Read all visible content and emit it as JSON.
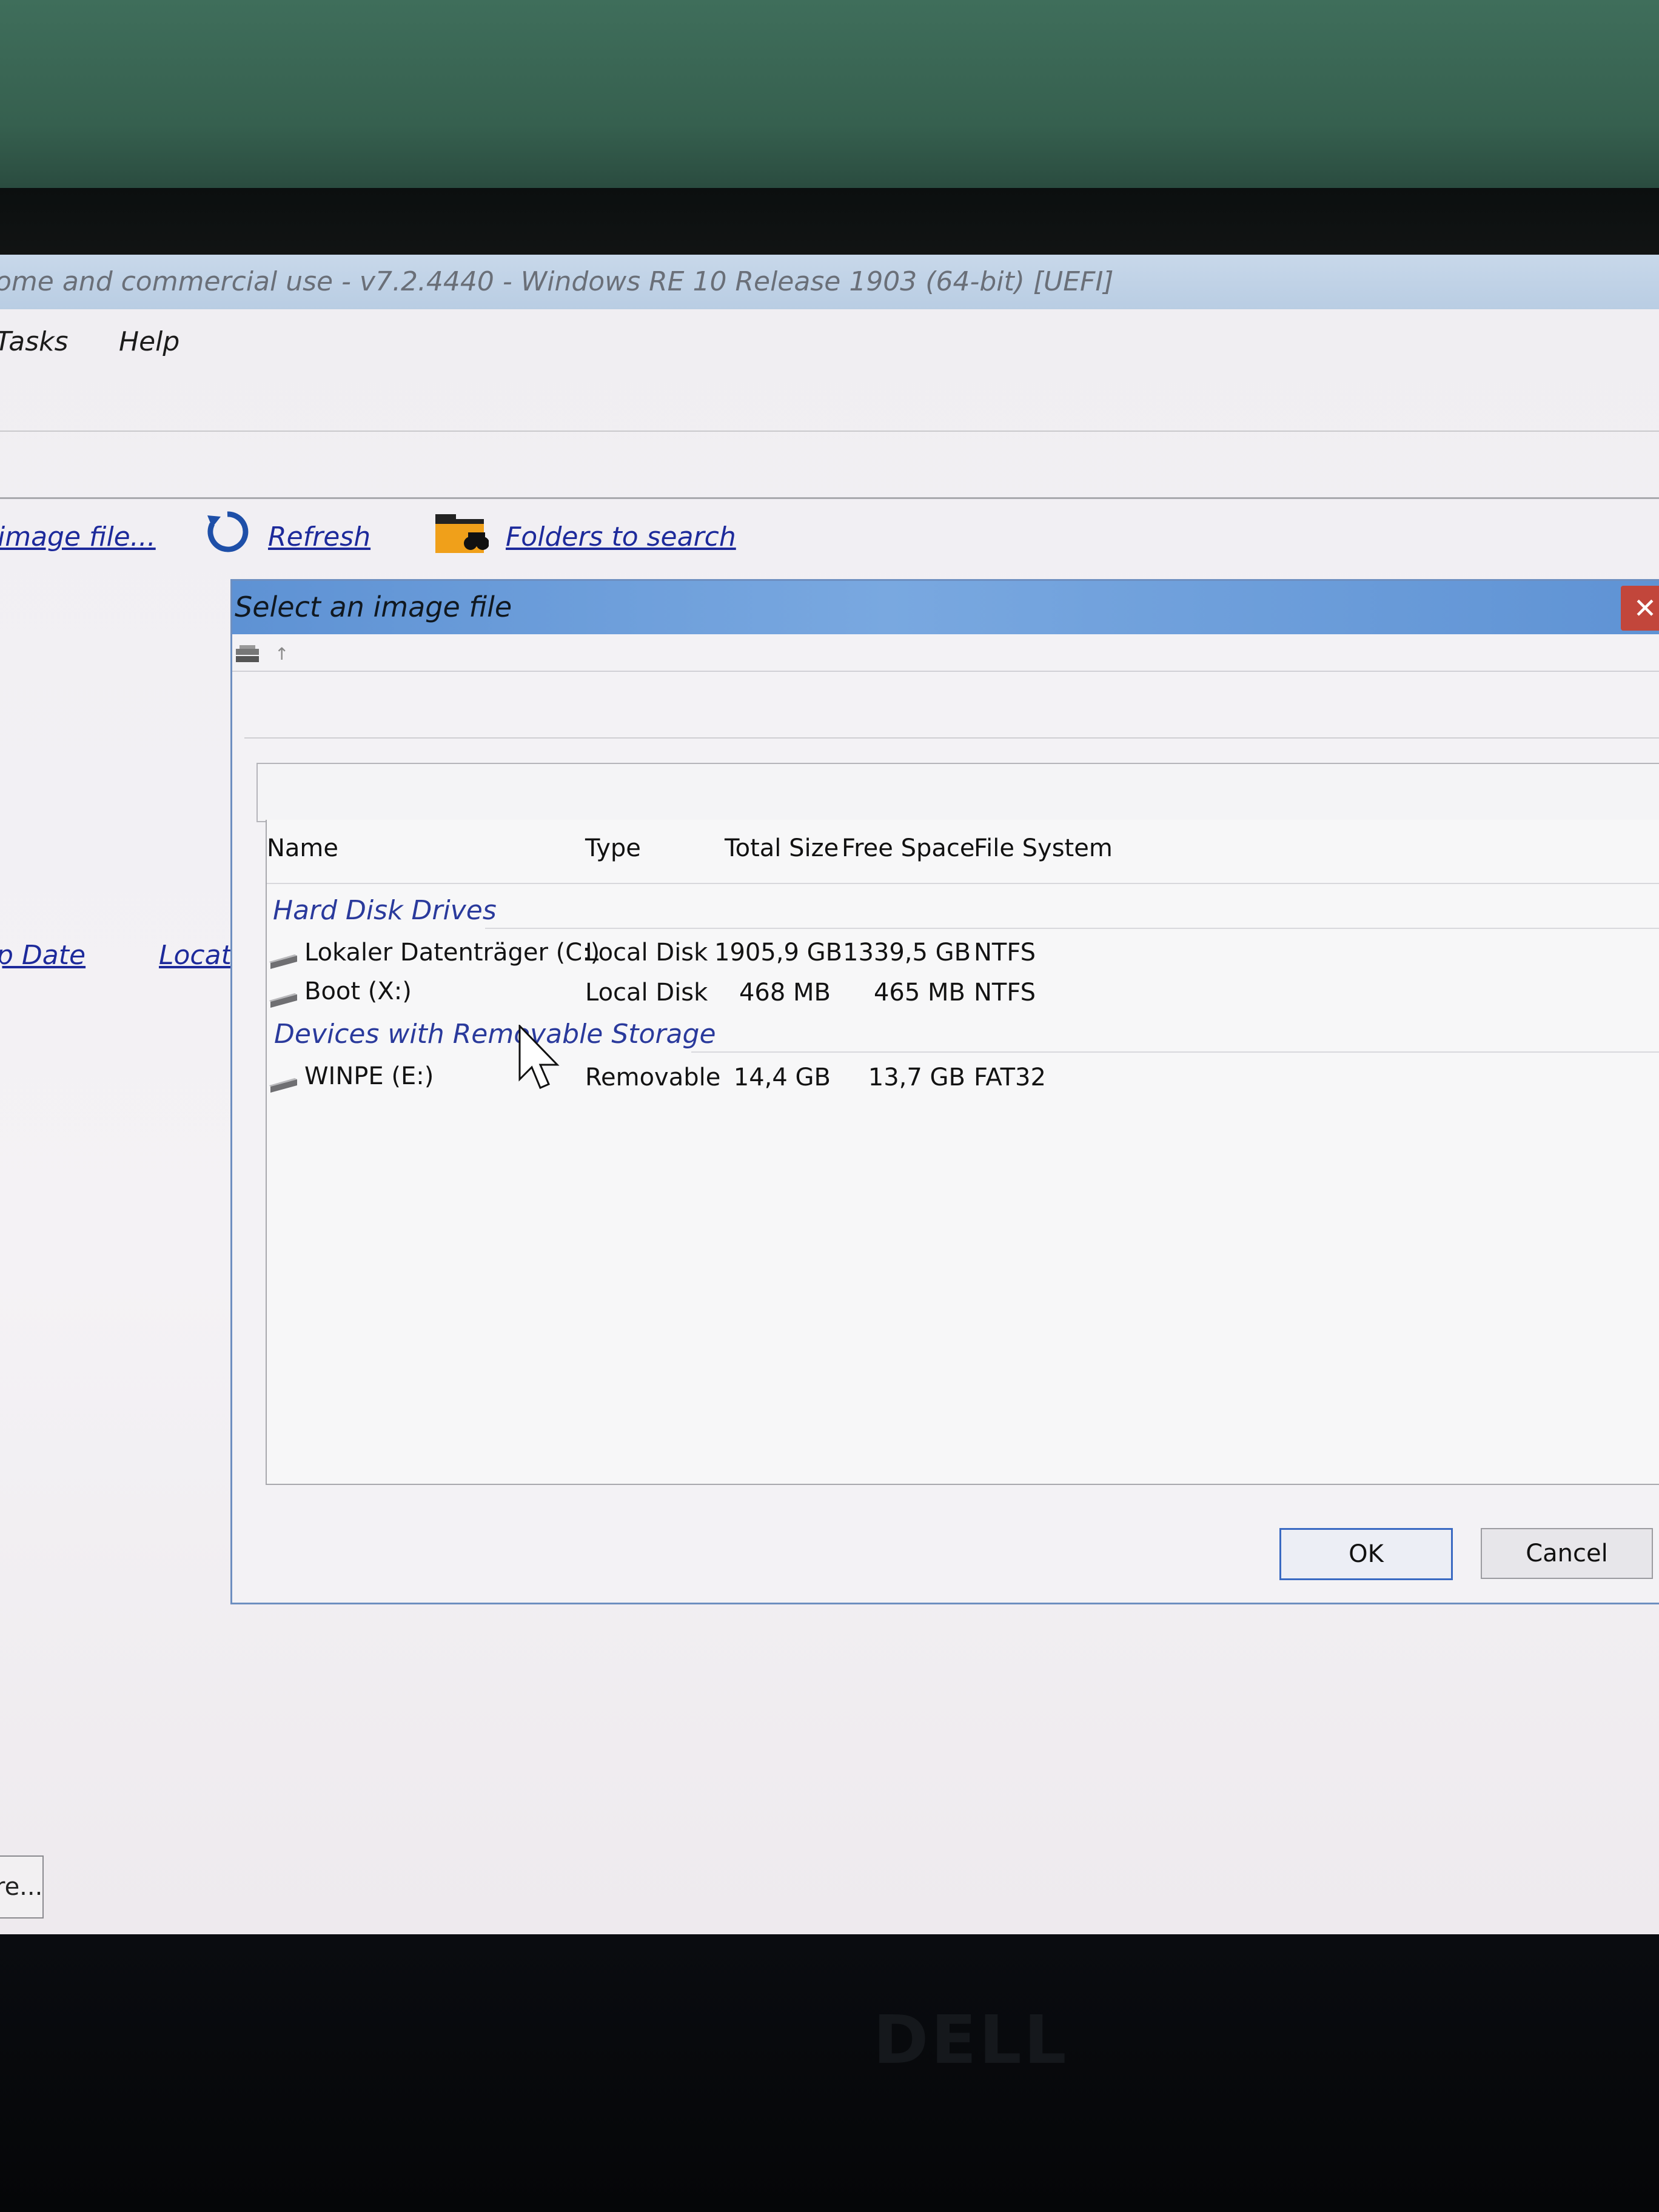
{
  "window": {
    "title": "ome and commercial use - v7.2.4440 - Windows RE 10 Release 1903 (64-bit)  [UEFI]"
  },
  "menu": {
    "items": [
      "Tasks",
      "Help"
    ]
  },
  "toolbar": {
    "image_file_label": "image file...",
    "refresh_label": "Refresh",
    "folders_label": "Folders to search"
  },
  "left_columns": {
    "date_label": "p Date",
    "location_label": "Locati"
  },
  "bottom_button": {
    "label": "re..."
  },
  "dialog": {
    "title": "Select an image file",
    "close_glyph": "✕",
    "columns": {
      "name": "Name",
      "type": "Type",
      "total": "Total Size",
      "free": "Free Space",
      "fs": "File System"
    },
    "groups": [
      {
        "label": "Hard Disk Drives",
        "rows": [
          {
            "name": "Lokaler Datenträger (C:)",
            "type": "Local Disk",
            "total": "1905,9 GB",
            "free": "1339,5 GB",
            "fs": "NTFS"
          },
          {
            "name": "Boot (X:)",
            "type": "Local Disk",
            "total": "468 MB",
            "free": "465 MB",
            "fs": "NTFS"
          }
        ]
      },
      {
        "label": "Devices with Removable Storage",
        "rows": [
          {
            "name": "WINPE (E:)",
            "type": "Removable",
            "total": "14,4 GB",
            "free": "13,7 GB",
            "fs": "FAT32"
          }
        ]
      }
    ],
    "ok_label": "OK",
    "cancel_label": "Cancel"
  },
  "brand": "DELL",
  "icons": {
    "refresh": "refresh-icon",
    "folder_search": "folder-search-icon",
    "drive": "drive-icon",
    "close": "close-icon",
    "cursor": "mouse-cursor-icon"
  },
  "colors": {
    "link": "#1d2a9b",
    "dialog_title": "#5e92d4",
    "group_text": "#2a3a9c",
    "close_button": "#c2463b"
  }
}
